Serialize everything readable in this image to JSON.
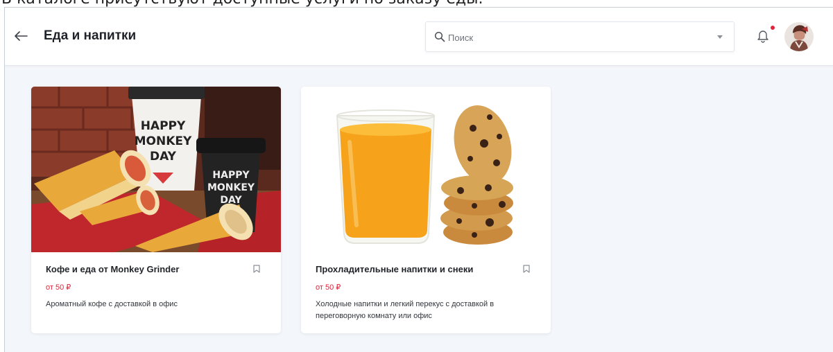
{
  "caption": "В каталоге присутствуют доступные услуги по заказу еды.",
  "header": {
    "title": "Еда и напитки",
    "back_icon": "arrow-left-icon"
  },
  "search": {
    "placeholder": "Поиск",
    "value": "",
    "icon": "search-icon",
    "dropdown_icon": "chevron-down-icon"
  },
  "notifications": {
    "icon": "bell-icon",
    "has_unread": true
  },
  "colors": {
    "price": "#e0243a",
    "notification_dot": "#e0243a",
    "background": "#f3f6fa"
  },
  "cards": [
    {
      "title": "Кофе и еда от Monkey Grinder",
      "price": "от 50 ₽",
      "description": "Ароматный кофе с доставкой в офис",
      "image_cup_text_1": "HAPPY",
      "image_cup_text_2": "MONKEY",
      "image_cup_text_3": "DAY"
    },
    {
      "title": "Прохладительные напитки и снеки",
      "price": "от 50 ₽",
      "description": "Холодные напитки и легкий перекус с доставкой в переговорную комнату или офис"
    }
  ]
}
